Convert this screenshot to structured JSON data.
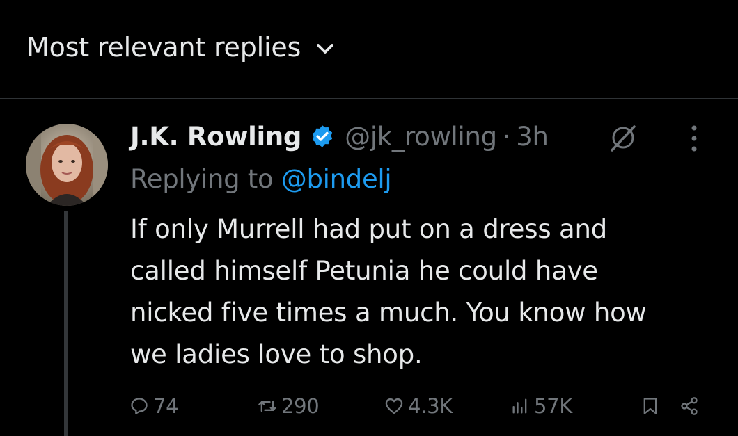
{
  "sort": {
    "label": "Most relevant replies",
    "icon": "chevron-down-icon"
  },
  "tweet": {
    "author": {
      "name": "J.K. Rowling",
      "handle": "@jk_rowling",
      "verified": true,
      "verified_color": "#1d9bf0",
      "avatar": "avatar"
    },
    "separator": "·",
    "time": "3h",
    "reply_prefix": "Replying to",
    "reply_to": "@bindelj",
    "text_lines": [
      "If only Murrell had put on a dress and",
      "called himself Petunia he could have",
      "nicked five times a much. You know how",
      "we ladies love to shop."
    ],
    "stats": {
      "replies": "74",
      "reposts": "290",
      "likes": "4.3K",
      "views": "57K"
    }
  },
  "colors": {
    "background": "#000000",
    "text": "#e7e9ea",
    "muted": "#71767b",
    "accent": "#1d9bf0",
    "border": "#2f3336"
  }
}
